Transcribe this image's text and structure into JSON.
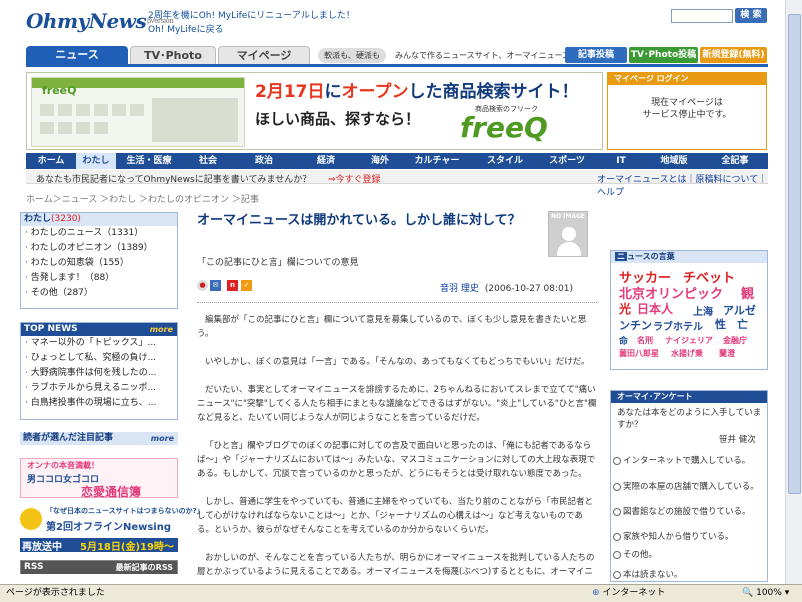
{
  "header": {
    "logo": "OhmyNews",
    "logo_beta": "βversion",
    "topmsg_line1": "2周年を機にOh! MyLifeにリニューアルしました！",
    "topmsg_line2": "Oh! MyLifeに戻る",
    "search_placeholder": "",
    "search_button": "検 索"
  },
  "tabs": {
    "news": "ニュース",
    "tv": "TV･Photo",
    "mypage": "マイページ"
  },
  "tagline_a": "軟派も、硬派も",
  "tagline_b": "みんなで作るニュースサイト、オーマイニュース",
  "buttons": {
    "post": "記事投稿",
    "tvphoto": "TV･Photo投稿",
    "register": "新規登録(無料)"
  },
  "banner": {
    "title_a": "2月17日",
    "title_b": "に",
    "title_c": "オープン",
    "title_d": "した商品検索サイト！",
    "sub": "ほしい商品、探すなら！",
    "brand_caption": "商品検索のフリーク",
    "brand": "freeQ",
    "mini_logo": "freeQ"
  },
  "login": {
    "title": "マイページ ログイン",
    "text_line1": "現在マイページは",
    "text_line2": "サービス停止中です。"
  },
  "catnav": [
    {
      "label": "ホーム",
      "active": false
    },
    {
      "label": "わたし",
      "active": true
    },
    {
      "label": "生活・医療",
      "active": false
    },
    {
      "label": "社会",
      "active": false
    },
    {
      "label": "政治",
      "active": false
    },
    {
      "label": "経済",
      "active": false
    },
    {
      "label": "海外",
      "active": false
    },
    {
      "label": "カルチャー",
      "active": false
    },
    {
      "label": "スタイル",
      "active": false
    },
    {
      "label": "スポーツ",
      "active": false
    },
    {
      "label": "IT",
      "active": false
    },
    {
      "label": "地域版",
      "active": false
    },
    {
      "label": "全記事",
      "active": false
    }
  ],
  "infobar": {
    "left": "あなたも市民記者になってOhmyNewsに記事を書いてみませんか？",
    "link": "⇒今すぐ登録",
    "right": "オーマイニュースとは｜原稿料について｜ヘルプ"
  },
  "breadcrumb": "ホーム＞ニュース ＞わたし ＞わたしのオピニオン ＞記事",
  "sidebar": {
    "watashi_title": "わたし",
    "watashi_count": "(3230)",
    "watashi_items": [
      "わたしのニュース（1331）",
      "わたしのオピニオン（1389）",
      "わたしの知恵袋（155）",
      "告発します！（88）",
      "その他（287）"
    ],
    "top_news_title": "TOP NEWS",
    "more": "more",
    "top_news_items": [
      "マネー以外の「トピックス」...",
      "ひょっとして私、究極の負け...",
      "大野病院事件は何を残したの...",
      "ラブホテルから見えるニッポ...",
      "白鳥拷投事件の現場に立ち、..."
    ],
    "reader_title": "読者が選んだ注目記事",
    "ad1_line1": "オンナの本音満載！",
    "ad1_line2": "男ココロ女ゴコロ",
    "ad1_line3": "恋愛通信簿",
    "ad2_line1": "「なぜ日本のニュースサイトはつまらないのか?」",
    "ad2_line2": "第2回オフラインNewsing",
    "ad2_line3": "再放送中",
    "ad2_line4": "5月18日(金)19時〜",
    "rss": "RSS",
    "rss_link": "最新記事のRSS"
  },
  "article": {
    "noimage": "NO IMAGE",
    "title": "オーマイニュースは開かれている。しかし誰に対して？",
    "subtitle": "「この記事にひと言」欄についての意見",
    "author": "音羽 理史",
    "date": "(2006-10-27 08:01)",
    "paragraphs": [
      "編集部が「この記事にひと言」欄について意見を募集しているので、ぼくも少し意見を書きたいと思う。",
      "いやしかし、ぼくの意見は「一言」である。「そんなの、あってもなくてもどっちでもいい」だけだ。",
      "だいたい、事実としてオーマイニュースを誹謗するために、2ちゃんねるにおいてスレまで立てて\"痛いニュース\"に\"突撃\"してくる人たち相手にまともな議論などできるはずがない。\"炎上\"している\"ひと言\"欄など見ると、たいてい同じような人が同じようなことを言っているだけだ。",
      "「ひと言」欄やブログでのぼくの記事に対しての言及で面白いと思ったのは、「俺にも記者であるならば〜」や「ジャーナリズムにおいては〜」みたいな、マスコミュニケーションに対しての大上段な表現である。もしかして、冗談で言っているのかと思ったが、どうにもそうとは受け取れない態度であった。",
      "しかし、普通に学生をやっていても、普通に主婦をやっていても、当たり前のことながら「市民記者として心がけなければならないことは〜」とか、「ジャーナリズムの心構えは〜」など考えないものである。というか、彼らがなぜそんなことを考えているのか分からないくらいだ。",
      "おかしいのが、そんなことを言っている人たちが、明らかにオーマイニュースを批判している人たちの層とかぶっているように見えることである。オーマイニュースを侮蔑(ぶべつ)するとともに、オーマイニ"
    ]
  },
  "keywords": {
    "title_n": "ニ",
    "title_rest": "ュースの言葉",
    "items": [
      "サッカー",
      "チベット",
      "北京オリンピック",
      "観",
      "光",
      "日本人",
      "上海",
      "アルゼ",
      "ンチン",
      "ラブホテル",
      "性",
      "亡",
      "命",
      "名刑",
      "ナイジェリア",
      "金融庁",
      "薗田八郎星",
      "水揚げ乗",
      "蘭澄"
    ]
  },
  "poll": {
    "title": "オーマイ･アンケート",
    "question": "あなたは本をどのように入手していますか？",
    "author": "笹井 健次",
    "options": [
      "インターネットで購入している。",
      "実際の本屋の店舗で購入している。",
      "図書館などの施設で借りている。",
      "家族や知人から借りている。",
      "その他。",
      "本は読まない。"
    ]
  },
  "statusbar": {
    "text": "ページが表示されました",
    "zone": "インターネット",
    "zoom": "100%"
  },
  "colors": {
    "brand_blue": "#1f5fb8",
    "nav_blue": "#1f4e96",
    "tv_green": "#3c9a34",
    "register_orange": "#e89a12"
  }
}
